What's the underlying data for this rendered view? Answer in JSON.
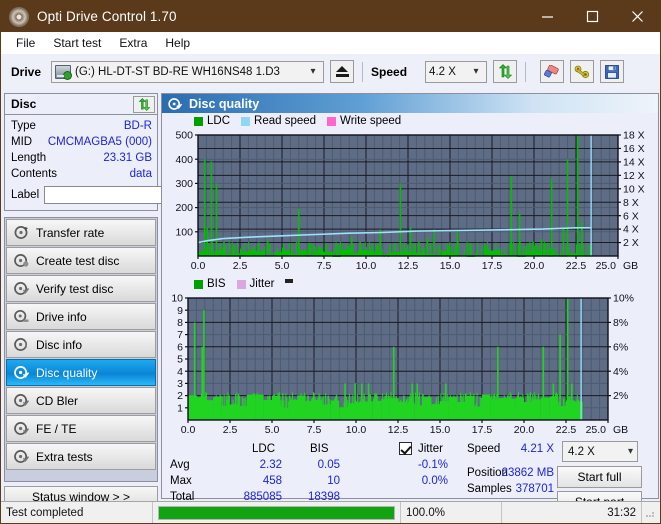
{
  "window": {
    "title": "Opti Drive Control 1.70",
    "icon": "disc-icon",
    "minimize": "minimize-icon",
    "maximize": "maximize-icon",
    "close": "close-icon"
  },
  "menu": {
    "items": [
      "File",
      "Start test",
      "Extra",
      "Help"
    ]
  },
  "toolbar": {
    "drive_label": "Drive",
    "drive_value": "(G:)  HL-DT-ST BD-RE  WH16NS48 1.D3",
    "eject_icon": "eject-icon",
    "speed_label": "Speed",
    "speed_value": "4.2 X",
    "refresh_icon": "refresh-icon",
    "erase_icon": "eraser-icon",
    "tools_icon": "wrench-icon",
    "save_icon": "save-floppy-icon"
  },
  "disc_panel": {
    "title": "Disc",
    "refresh_icon": "refresh-icon",
    "rows": [
      {
        "key": "Type",
        "value": "BD-R"
      },
      {
        "key": "MID",
        "value": "CMCMAGBA5 (000)"
      },
      {
        "key": "Length",
        "value": "23.31 GB"
      },
      {
        "key": "Contents",
        "value": "data"
      }
    ],
    "label_key": "Label",
    "label_value": "",
    "label_placeholder": "",
    "label_button_icon": "disc-icon"
  },
  "nav": {
    "items": [
      {
        "label": "Transfer rate",
        "icon": "disc-speed-icon",
        "active": false
      },
      {
        "label": "Create test disc",
        "icon": "disc-write-icon",
        "active": false
      },
      {
        "label": "Verify test disc",
        "icon": "disc-verify-icon",
        "active": false
      },
      {
        "label": "Drive info",
        "icon": "disc-drive-icon",
        "active": false
      },
      {
        "label": "Disc info",
        "icon": "disc-info-icon",
        "active": false
      },
      {
        "label": "Disc quality",
        "icon": "disc-quality-icon",
        "active": true
      },
      {
        "label": "CD Bler",
        "icon": "disc-bler-icon",
        "active": false
      },
      {
        "label": "FE / TE",
        "icon": "disc-fete-icon",
        "active": false
      },
      {
        "label": "Extra tests",
        "icon": "disc-extra-icon",
        "active": false
      }
    ],
    "status_window": "Status window > >"
  },
  "panel": {
    "header": "Disc quality",
    "header_icon": "disc-quality-icon"
  },
  "chart_data": [
    {
      "type": "line",
      "name": "ldc-chart",
      "title": "",
      "xlabel": "GB",
      "ylabel": "",
      "x": [
        0,
        2.5,
        5.0,
        7.5,
        10.0,
        12.5,
        15.0,
        17.5,
        20.0,
        22.5,
        25.0
      ],
      "xlim": [
        0,
        25.0
      ],
      "xticks": [
        "0.0",
        "2.5",
        "5.0",
        "7.5",
        "10.0",
        "12.5",
        "15.0",
        "17.5",
        "20.0",
        "22.5",
        "25.0"
      ],
      "xunit": "GB",
      "ylim": [
        0,
        500
      ],
      "yticks": [
        100,
        200,
        300,
        400,
        500
      ],
      "y2lim": [
        0,
        18
      ],
      "y2ticks": [
        "2 X",
        "4 X",
        "6 X",
        "8 X",
        "10 X",
        "12 X",
        "14 X",
        "16 X",
        "18 X"
      ],
      "grid": true,
      "legend": [
        {
          "label": "LDC",
          "color": "#00a000"
        },
        {
          "label": "Read speed",
          "color": "#7fd4f5"
        },
        {
          "label": "Write speed",
          "color": "#ff66cc"
        }
      ],
      "series": [
        {
          "name": "LDC",
          "color": "#00c000",
          "peaks": [
            [
              0.35,
              400
            ],
            [
              0.75,
              390
            ],
            [
              1.05,
              300
            ],
            [
              0.5,
              120
            ],
            [
              1.5,
              60
            ],
            [
              2.1,
              45
            ],
            [
              3.3,
              40
            ],
            [
              4.1,
              70
            ],
            [
              5.0,
              35
            ],
            [
              5.95,
              195
            ],
            [
              6.6,
              55
            ],
            [
              7.2,
              40
            ],
            [
              8.4,
              45
            ],
            [
              9.1,
              80
            ],
            [
              9.6,
              60
            ],
            [
              10.8,
              110
            ],
            [
              11.4,
              50
            ],
            [
              12.0,
              300
            ],
            [
              12.6,
              120
            ],
            [
              13.1,
              60
            ],
            [
              13.6,
              75
            ],
            [
              14.0,
              110
            ],
            [
              15.4,
              100
            ],
            [
              16.2,
              45
            ],
            [
              17.0,
              50
            ],
            [
              18.6,
              330
            ],
            [
              19.1,
              180
            ],
            [
              19.9,
              60
            ],
            [
              20.4,
              70
            ],
            [
              21.0,
              320
            ],
            [
              21.7,
              115
            ],
            [
              21.95,
              400
            ],
            [
              22.55,
              515
            ],
            [
              22.8,
              140
            ]
          ]
        },
        {
          "name": "Read speed",
          "color": "#9fe0fa",
          "points": [
            [
              0.0,
              2.0
            ],
            [
              0.6,
              2.3
            ],
            [
              1.5,
              2.6
            ],
            [
              3.0,
              2.8
            ],
            [
              5.0,
              3.0
            ],
            [
              7.0,
              3.2
            ],
            [
              9.0,
              3.4
            ],
            [
              11.0,
              3.5
            ],
            [
              13.0,
              3.7
            ],
            [
              15.5,
              3.8
            ],
            [
              18.0,
              3.9
            ],
            [
              20.5,
              4.0
            ],
            [
              22.5,
              4.2
            ],
            [
              23.4,
              4.2
            ]
          ]
        }
      ],
      "end_marker": 23.4
    },
    {
      "type": "line",
      "name": "bis-chart",
      "title": "",
      "xlabel": "GB",
      "x": [
        0,
        2.5,
        5.0,
        7.5,
        10.0,
        12.5,
        15.0,
        17.5,
        20.0,
        22.5,
        25.0
      ],
      "xlim": [
        0,
        25.0
      ],
      "xticks": [
        "0.0",
        "2.5",
        "5.0",
        "7.5",
        "10.0",
        "12.5",
        "15.0",
        "17.5",
        "20.0",
        "22.5",
        "25.0"
      ],
      "xunit": "GB",
      "ylim": [
        0,
        10
      ],
      "yticks": [
        1,
        2,
        3,
        4,
        5,
        6,
        7,
        8,
        9,
        10
      ],
      "y2lim": [
        0,
        10
      ],
      "y2ticks": [
        "2%",
        "4%",
        "6%",
        "8%",
        "10%"
      ],
      "grid": true,
      "legend": [
        {
          "label": "BIS",
          "color": "#00a000"
        },
        {
          "label": "Jitter",
          "color": "#d9a8e0"
        }
      ],
      "series": [
        {
          "name": "BIS",
          "color": "#22d422",
          "baseline": 1.0,
          "peaks": [
            [
              0.35,
              8
            ],
            [
              0.9,
              9
            ],
            [
              0.8,
              6
            ],
            [
              1.9,
              2
            ],
            [
              2.4,
              2
            ],
            [
              3.0,
              2
            ],
            [
              3.6,
              2
            ],
            [
              4.2,
              2
            ],
            [
              4.8,
              2
            ],
            [
              5.4,
              2
            ],
            [
              6.0,
              2
            ],
            [
              6.6,
              2
            ],
            [
              7.1,
              2
            ],
            [
              7.8,
              2
            ],
            [
              8.3,
              2
            ],
            [
              8.8,
              2
            ],
            [
              9.3,
              3
            ],
            [
              9.9,
              3
            ],
            [
              10.3,
              3
            ],
            [
              10.7,
              3
            ],
            [
              11.2,
              2
            ],
            [
              11.7,
              2
            ],
            [
              12.2,
              6
            ],
            [
              12.8,
              2
            ],
            [
              13.3,
              3
            ],
            [
              13.6,
              3
            ],
            [
              14.3,
              2
            ],
            [
              15.3,
              3
            ],
            [
              16.2,
              2
            ],
            [
              16.8,
              2
            ],
            [
              17.5,
              2
            ],
            [
              18.4,
              6
            ],
            [
              19.0,
              2
            ],
            [
              19.6,
              2
            ],
            [
              20.2,
              2
            ],
            [
              21.1,
              6
            ],
            [
              21.7,
              3
            ],
            [
              22.1,
              7
            ],
            [
              22.55,
              10
            ],
            [
              22.8,
              3
            ]
          ]
        }
      ],
      "end_marker": 23.4
    }
  ],
  "stats": {
    "col_ldc": "LDC",
    "col_bis": "BIS",
    "rows": [
      {
        "key": "Avg",
        "ldc": "2.32",
        "bis": "0.05"
      },
      {
        "key": "Max",
        "ldc": "458",
        "bis": "10"
      },
      {
        "key": "Total",
        "ldc": "885085",
        "bis": "18398"
      }
    ],
    "jitter_label": "Jitter",
    "jitter_checked": true,
    "jitter_avg": "-0.1%",
    "jitter_max": "0.0%",
    "speed_key": "Speed",
    "speed_value": "4.21 X",
    "position_key": "Position",
    "position_value": "23862 MB",
    "samples_key": "Samples",
    "samples_value": "378701",
    "speed_select": "4.2 X",
    "start_full": "Start full",
    "start_part": "Start part"
  },
  "statusbar": {
    "text": "Test completed",
    "progress_percent": 100.0,
    "progress_label": "100.0%",
    "elapsed": "31:32"
  },
  "colors": {
    "titlebar": "#5b3a1b",
    "accent": "#1c24d8",
    "active_nav": "#0b85d6",
    "plot_bg": "#5d6b85",
    "ldc_green": "#00c000",
    "read_speed": "#9fe0fa",
    "progress": "#12a312"
  }
}
